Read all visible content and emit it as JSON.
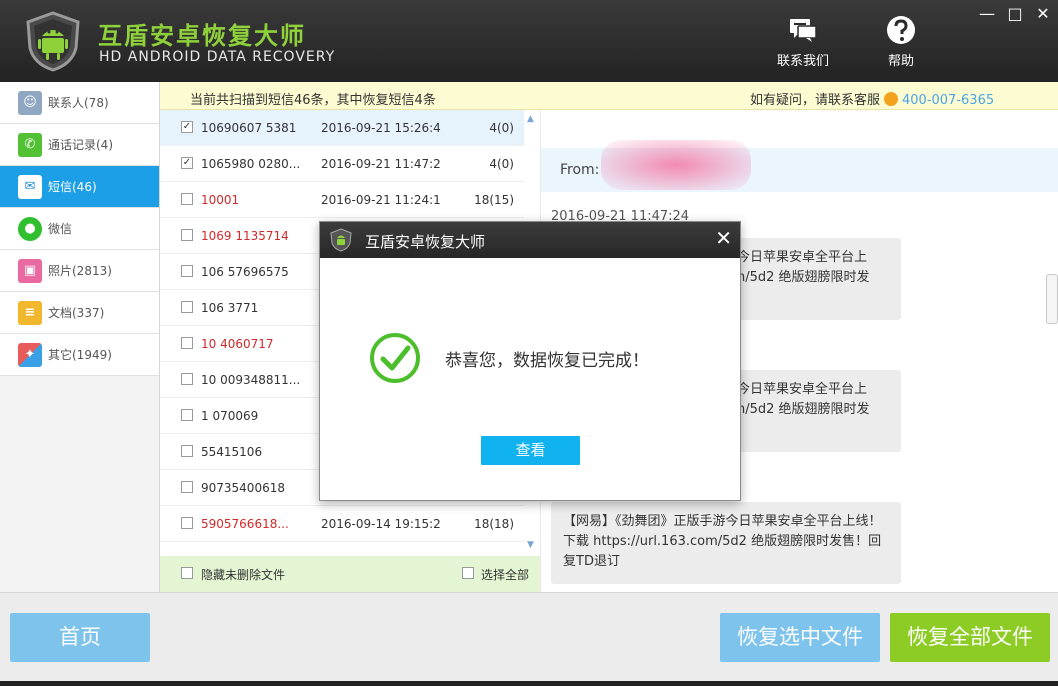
{
  "app": {
    "title_cn": "互盾安卓恢复大师",
    "title_en": "HD ANDROID DATA RECOVERY",
    "contact_label": "联系我们",
    "help_label": "帮助",
    "minimize": "—",
    "maximize": "□",
    "close": "✕"
  },
  "sidebar": {
    "items": [
      {
        "label": "联系人(78)",
        "icon": "contacts-icon",
        "color": "#8fa7c2"
      },
      {
        "label": "通话记录(4)",
        "icon": "phone-icon",
        "color": "#52c234"
      },
      {
        "label": "短信(46)",
        "icon": "sms-icon",
        "color": "#1d8dd6"
      },
      {
        "label": "微信",
        "icon": "wechat-icon",
        "color": "#2fbf2f"
      },
      {
        "label": "照片(2813)",
        "icon": "photo-icon",
        "color": "#e86aa0"
      },
      {
        "label": "文档(337)",
        "icon": "document-icon",
        "color": "#f1b82d"
      },
      {
        "label": "其它(1949)",
        "icon": "other-icon",
        "color": "#e85b5b"
      }
    ]
  },
  "infobar": {
    "left": "当前共扫描到短信46条，其中恢复短信4条",
    "right_prefix": "如有疑问，请联系客服",
    "phone": "400-007-6365"
  },
  "list": {
    "rows": [
      {
        "number": "10690607  5381",
        "datetime": "2016-09-21 15:26:4",
        "count": "4(0)",
        "checked": true,
        "red": false
      },
      {
        "number": "1065980   0280...",
        "datetime": "2016-09-21 11:47:2",
        "count": "4(0)",
        "checked": true,
        "red": false
      },
      {
        "number": "10001",
        "datetime": "2016-09-21 11:24:1",
        "count": "18(15)",
        "checked": false,
        "red": true
      },
      {
        "number": "1069   1135714",
        "datetime": "",
        "count": "",
        "checked": false,
        "red": true
      },
      {
        "number": "106   57696575",
        "datetime": "",
        "count": "",
        "checked": false,
        "red": false
      },
      {
        "number": "106   3771",
        "datetime": "",
        "count": "",
        "checked": false,
        "red": false
      },
      {
        "number": "10   4060717",
        "datetime": "",
        "count": "",
        "checked": false,
        "red": true
      },
      {
        "number": "10   009348811...",
        "datetime": "",
        "count": "",
        "checked": false,
        "red": false
      },
      {
        "number": "1   070069",
        "datetime": "",
        "count": "",
        "checked": false,
        "red": false
      },
      {
        "number": "   55415106",
        "datetime": "",
        "count": "",
        "checked": false,
        "red": false
      },
      {
        "number": "   90735400618",
        "datetime": "",
        "count": "",
        "checked": false,
        "red": false
      },
      {
        "number": "   5905766618...",
        "datetime": "2016-09-14 19:15:2",
        "count": "18(18)",
        "checked": false,
        "red": true
      }
    ],
    "hide_label": "隐藏未删除文件",
    "select_all_label": "选择全部"
  },
  "detail": {
    "from_label": "From:",
    "date": "2016-09-21 11:47:24",
    "bubble1_line1": "今日苹果安卓全平台上",
    "bubble1_line2": "n/5d2 绝版翅膀限时发",
    "bubble2_line1": "今日苹果安卓全平台上",
    "bubble2_line2": "n/5d2 绝版翅膀限时发",
    "bubble3": "【网易】《劲舞团》正版手游今日苹果安卓全平台上线！下载 https://url.163.com/5d2 绝版翅膀限时发售！回复TD退订"
  },
  "dialog": {
    "title": "互盾安卓恢复大师",
    "message": "恭喜您，数据恢复已完成！",
    "view_label": "查看",
    "close": "✕"
  },
  "bottom": {
    "home_label": "首页",
    "recover_selected_label": "恢复选中文件",
    "recover_all_label": "恢复全部文件"
  },
  "colors": {
    "accent_blue": "#1c9fe6",
    "accent_green": "#8ccc24",
    "title_green": "#8fd13b"
  }
}
